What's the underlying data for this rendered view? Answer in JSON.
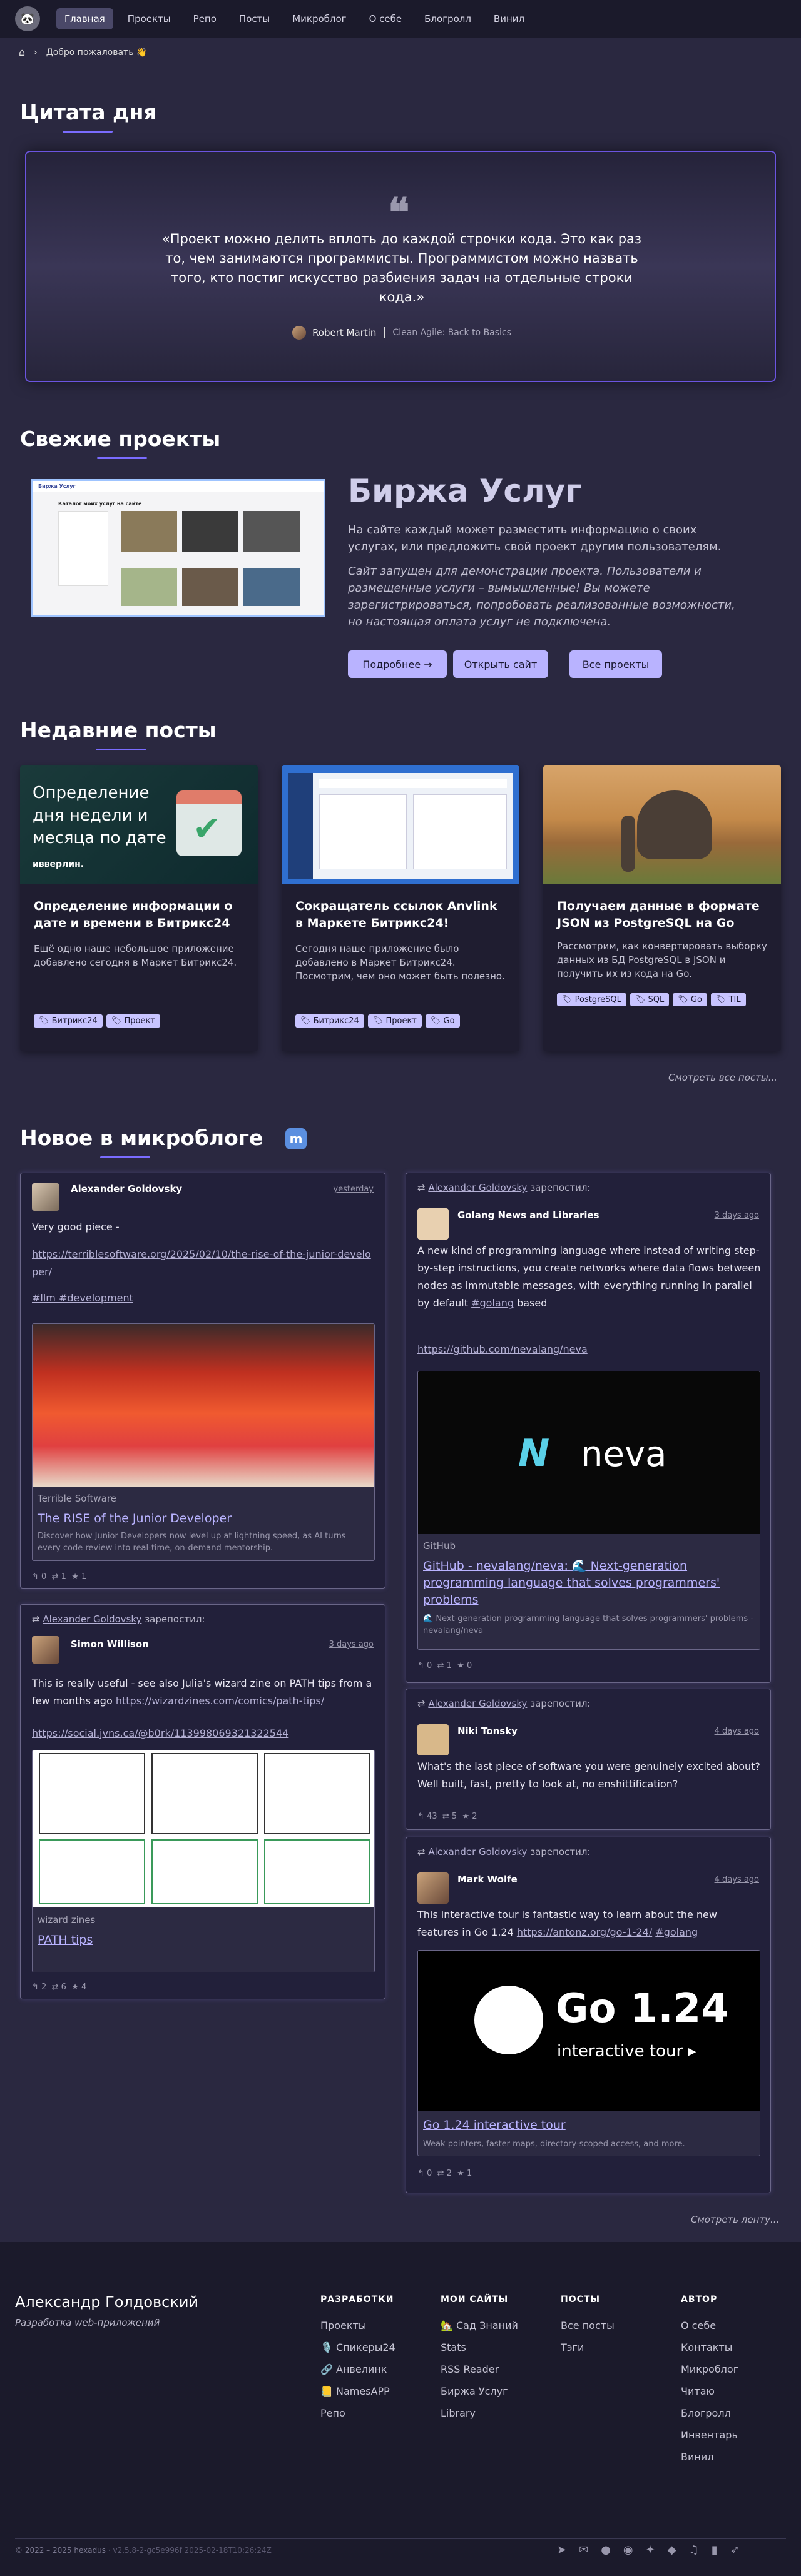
{
  "nav": {
    "items": [
      "Главная",
      "Проекты",
      "Репо",
      "Посты",
      "Микроблог",
      "О себе",
      "Блогролл",
      "Винил"
    ]
  },
  "breadcrumb": {
    "label": "Добро пожаловать 👋"
  },
  "quote": {
    "heading": "Цитата дня",
    "text": "«Проект можно делить вплоть до каждой строчки кода. Это как раз то, чем занимаются программисты. Программистом можно назвать того, кто постиг искусство разбиения задач на отдельные строки кода.»",
    "author": "Robert Martin",
    "source": "Clean Agile: Back to Basics"
  },
  "projects": {
    "heading": "Свежие проекты",
    "title": "Биржа Услуг",
    "desc1": "На сайте каждый может разместить информацию о своих услугах, или предложить свой проект другим пользователям.",
    "desc2": "Сайт запущен для демонстрации проекта. Пользователи и размещенные услуги – вымышленные! Вы можете зарегистрироваться, попробовать реализованные возможности, но настоящая оплата услуг не подключена.",
    "buttons": [
      "Подробнее →",
      "Открыть сайт",
      "Все проекты"
    ],
    "shot": {
      "brand": "Биржа Услуг",
      "heading": "Каталог моих услуг на сайте"
    }
  },
  "posts": {
    "heading": "Недавние посты",
    "more": "Смотреть все посты...",
    "items": [
      {
        "title": "Определение информации о дате и времени в Битрикс24",
        "desc": "Ещё одно наше небольшое приложение добавлено сегодня в Маркет Битрикс24.",
        "tags": [
          "Битрикс24",
          "Проект"
        ],
        "img_text": "Определение дня недели и месяца по дате",
        "img_brand": "ивверлин."
      },
      {
        "title": "Сокращатель ссылок Anvlink в Маркете Битрикс24!",
        "desc": "Сегодня наше приложение было добавлено в Маркет Битрикс24. Посмотрим, чем оно может быть полезно.",
        "tags": [
          "Битрикс24",
          "Проект",
          "Go"
        ]
      },
      {
        "title": "Получаем данные в формате JSON из PostgreSQL на Go",
        "desc": "Рассмотрим, как конвертировать выборку данных из БД PostgreSQL в JSON и получить их из кода на Go.",
        "tags": [
          "PostgreSQL",
          "SQL",
          "Go",
          "TIL"
        ]
      }
    ]
  },
  "micro": {
    "heading": "Новое в микроблоге",
    "more": "Смотреть ленту...",
    "reposted": "зарепостил:",
    "reposter": "Alexander Goldovsky",
    "p1": {
      "name": "Alexander Goldovsky",
      "date": "yesterday",
      "text": "Very good piece -",
      "url": "https://terriblesoftware.org/2025/02/10/the-rise-of-the-junior-developer/",
      "hashtags": "#llm #development",
      "src": "Terrible Software",
      "ltitle": "The RISE of the Junior Developer",
      "ldesc": "Discover how Junior Developers now level up at lightning speed, as AI turns every code review into real-time, on-demand mentorship.",
      "stats": [
        "0",
        "1",
        "1"
      ]
    },
    "p2": {
      "name": "Simon Willison",
      "date": "3 days ago",
      "text": "This is really useful - see also Julia's wizard zine on PATH tips from a few months ago",
      "url1": "https://wizardzines.com/comics/path-tips/",
      "url2": "https://social.jvns.ca/@b0rk/113998069321322544",
      "src": "wizard zines",
      "ltitle": "PATH tips",
      "stats": [
        "2",
        "6",
        "4"
      ]
    },
    "p3": {
      "name": "Golang News and Libraries",
      "date": "3 days ago",
      "text": "A new kind of programming language where instead of writing step-by-step instructions, you create networks where data flows between nodes as immutable messages, with everything running in parallel by default",
      "tag": "#golang",
      "tagafter": " based",
      "url": "https://github.com/nevalang/neva",
      "brand": "neva",
      "src": "GitHub",
      "ltitle": "GitHub - nevalang/neva: 🌊 Next-generation programming language that solves programmers' problems",
      "ldesc": "🌊 Next-generation programming language that solves programmers' problems - nevalang/neva",
      "stats": [
        "0",
        "1",
        "0"
      ]
    },
    "p4": {
      "name": "Niki Tonsky",
      "date": "4 days ago",
      "text": "What's the last piece of software you were genuinely excited about? Well built, fast, pretty to look at, no enshittification?",
      "stats": [
        "43",
        "5",
        "2"
      ]
    },
    "p5": {
      "name": "Mark Wolfe",
      "date": "4 days ago",
      "text": "This interactive tour is fantastic way to learn about the new features in Go 1.24",
      "url": "https://antonz.org/go-1-24/",
      "tag": "#golang",
      "big": "Go 1.24",
      "sub": "interactive tour ▸",
      "ltitle": "Go 1.24 interactive tour",
      "ldesc": "Weak pointers, faster maps, directory-scoped access, and more.",
      "stats": [
        "0",
        "2",
        "1"
      ]
    }
  },
  "footer": {
    "name": "Александр Голдовский",
    "sub": "Разработка web-приложений",
    "cols": [
      {
        "h": "РАЗРАБОТКИ",
        "links": [
          "Проекты",
          "🎙️ Спикеры24",
          "🔗 Анвелинк",
          "📒 NamesAPP",
          "Репо"
        ]
      },
      {
        "h": "МОИ САЙТЫ",
        "links": [
          "🏡 Сад Знаний",
          "Stats",
          "RSS Reader",
          "Биржа Услуг",
          "Library"
        ]
      },
      {
        "h": "ПОСТЫ",
        "links": [
          "Все посты",
          "Тэги"
        ]
      },
      {
        "h": "АВТОР",
        "links": [
          "О себе",
          "Контакты",
          "Микроблог",
          "Читаю",
          "Блогролл",
          "Инвентарь",
          "Винил"
        ]
      }
    ],
    "copy": "© 2022 – 2025 hexadus",
    "version": "v2.5.8-2-gc5e996f 2025-02-18T10:26:24Z"
  }
}
